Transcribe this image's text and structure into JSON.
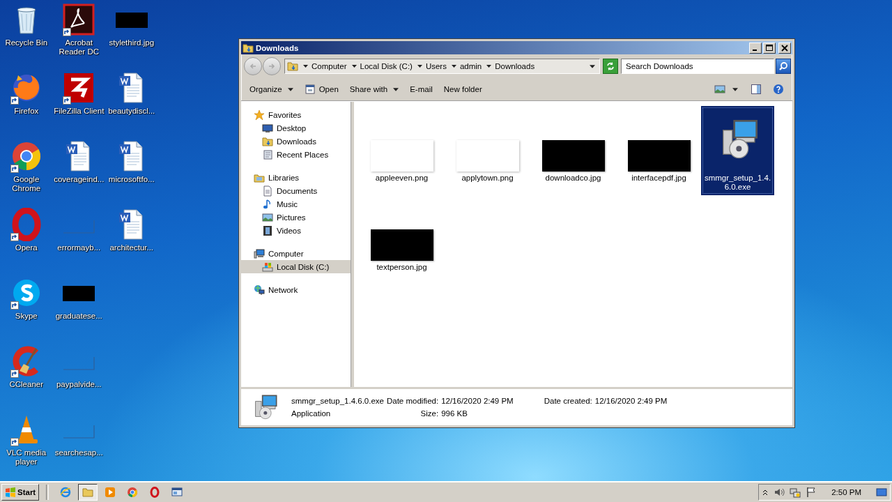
{
  "desktop": {
    "icons": [
      {
        "label": "Recycle Bin",
        "kind": "recycle",
        "shortcut": false
      },
      {
        "label": "Firefox",
        "kind": "fox",
        "shortcut": true
      },
      {
        "label": "Google Chrome",
        "kind": "chrome",
        "shortcut": true
      },
      {
        "label": "Opera",
        "kind": "opera",
        "shortcut": true
      },
      {
        "label": "Skype",
        "kind": "chat",
        "shortcut": true
      },
      {
        "label": "CCleaner",
        "kind": "cleaner",
        "shortcut": true
      },
      {
        "label": "VLC media player",
        "kind": "cone",
        "shortcut": true
      },
      {
        "label": "Acrobat Reader DC",
        "kind": "reader",
        "shortcut": true
      },
      {
        "label": "FileZilla Client",
        "kind": "zigzag",
        "shortcut": true
      },
      {
        "label": "coverageind...",
        "kind": "document",
        "shortcut": false
      },
      {
        "label": "errormayb...",
        "kind": "image-blank",
        "shortcut": false
      },
      {
        "label": "graduatese...",
        "kind": "image-dark",
        "shortcut": false
      },
      {
        "label": "paypalvide...",
        "kind": "image-blank",
        "shortcut": false
      },
      {
        "label": "searchesap...",
        "kind": "image-blank",
        "shortcut": false
      },
      {
        "label": "stylethird.jpg",
        "kind": "image-dark",
        "shortcut": false
      },
      {
        "label": "beautydiscl...",
        "kind": "document",
        "shortcut": false
      },
      {
        "label": "microsoftfo...",
        "kind": "document",
        "shortcut": false
      },
      {
        "label": "architectur...",
        "kind": "document",
        "shortcut": false
      }
    ]
  },
  "window": {
    "title": "Downloads",
    "address": [
      "Computer",
      "Local Disk (C:)",
      "Users",
      "admin",
      "Downloads"
    ],
    "search": {
      "placeholder": "Search Downloads"
    },
    "toolbar": [
      {
        "label": "Organize",
        "kind": "menu"
      },
      {
        "label": "Open",
        "kind": "open"
      },
      {
        "label": "Share with",
        "kind": "menu"
      },
      {
        "label": "E-mail",
        "kind": "plain"
      },
      {
        "label": "New folder",
        "kind": "plain"
      }
    ],
    "nav": [
      {
        "label": "Favorites",
        "kind": "star",
        "selected": false,
        "children": [
          {
            "label": "Desktop",
            "kind": "monitor",
            "selected": false
          },
          {
            "label": "Downloads",
            "kind": "folder",
            "selected": false
          },
          {
            "label": "Recent Places",
            "kind": "recent",
            "selected": false
          }
        ]
      },
      {
        "label": "Libraries",
        "kind": "library",
        "selected": false,
        "children": [
          {
            "label": "Documents",
            "kind": "doc",
            "selected": false
          },
          {
            "label": "Music",
            "kind": "note",
            "selected": false
          },
          {
            "label": "Pictures",
            "kind": "picture",
            "selected": false
          },
          {
            "label": "Videos",
            "kind": "film",
            "selected": false
          }
        ]
      },
      {
        "label": "Computer",
        "kind": "computer",
        "selected": false,
        "children": [
          {
            "label": "Local Disk (C:)",
            "kind": "drive",
            "selected": true
          }
        ]
      },
      {
        "label": "Network",
        "kind": "network",
        "selected": false
      }
    ],
    "files": [
      {
        "name": "appleeven.png",
        "kind": "image-blank",
        "selected": false
      },
      {
        "name": "applytown.png",
        "kind": "image-blank",
        "selected": false
      },
      {
        "name": "downloadco.jpg",
        "kind": "image-dark",
        "selected": false
      },
      {
        "name": "interfacepdf.jpg",
        "kind": "image-dark",
        "selected": false
      },
      {
        "name": "smmgr_setup_1.4.6.0.exe",
        "kind": "installer",
        "selected": true
      },
      {
        "name": "textperson.jpg",
        "kind": "image-dark",
        "selected": false
      }
    ],
    "details": {
      "name": "smmgr_setup_1.4.6.0.exe",
      "type": "Application",
      "fields": [
        {
          "label": "Date modified:",
          "value": "12/16/2020 2:49 PM"
        },
        {
          "label": "Date created:",
          "value": "12/16/2020 2:49 PM"
        },
        {
          "label": "Size:",
          "value": "996 KB"
        }
      ]
    }
  },
  "taskbar": {
    "start": "Start",
    "apps": [
      {
        "kind": "ie",
        "active": false
      },
      {
        "kind": "folder",
        "active": true
      },
      {
        "kind": "media",
        "active": false
      },
      {
        "kind": "chrome",
        "active": false
      },
      {
        "kind": "opera",
        "active": false
      },
      {
        "kind": "remote",
        "active": false
      }
    ],
    "clock": "2:50 PM"
  }
}
